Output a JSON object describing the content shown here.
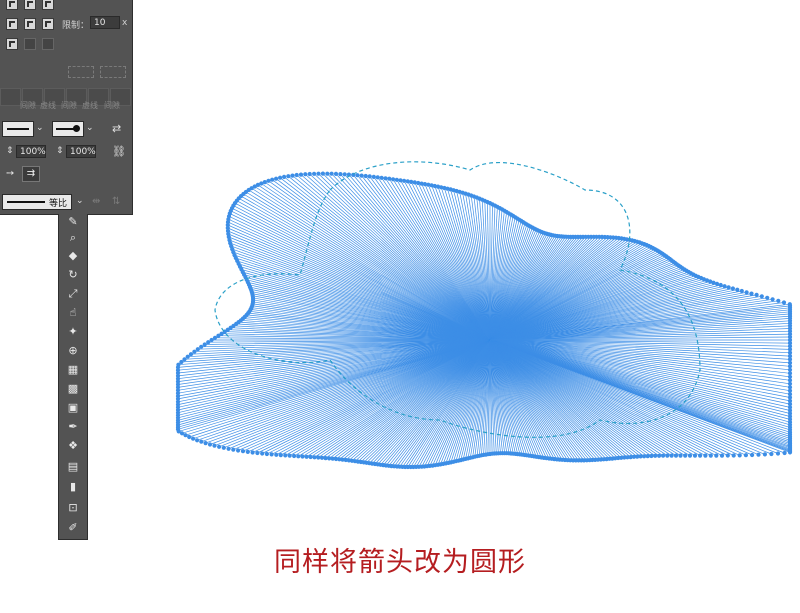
{
  "stroke_panel": {
    "limit_label": "限制：",
    "limit_value": "10",
    "limit_unit": "x",
    "dash_labels": [
      "虚线",
      "间隙",
      "虚线",
      "间隙",
      "虚线",
      "间隙"
    ],
    "scale_start": "100%",
    "scale_end": "100%",
    "profile_label": "等比"
  },
  "toolbar": {
    "tools": [
      "pencil-icon",
      "lasso-brush-icon",
      "eraser-icon",
      "rotate-icon",
      "scale-icon",
      "warp-icon",
      "pin-icon",
      "shape-builder-icon",
      "perspective-icon",
      "mesh-icon",
      "gradient-icon",
      "eyedropper-icon",
      "blend-icon",
      "symbol-sprayer-icon",
      "graph-icon",
      "artboard-icon",
      "slice-icon"
    ]
  },
  "artwork": {
    "stroke_color": "#3d8ee6",
    "dash_color": "#2aa0c8",
    "arrowhead": "circle"
  },
  "caption": "同样将箭头改为圆形"
}
